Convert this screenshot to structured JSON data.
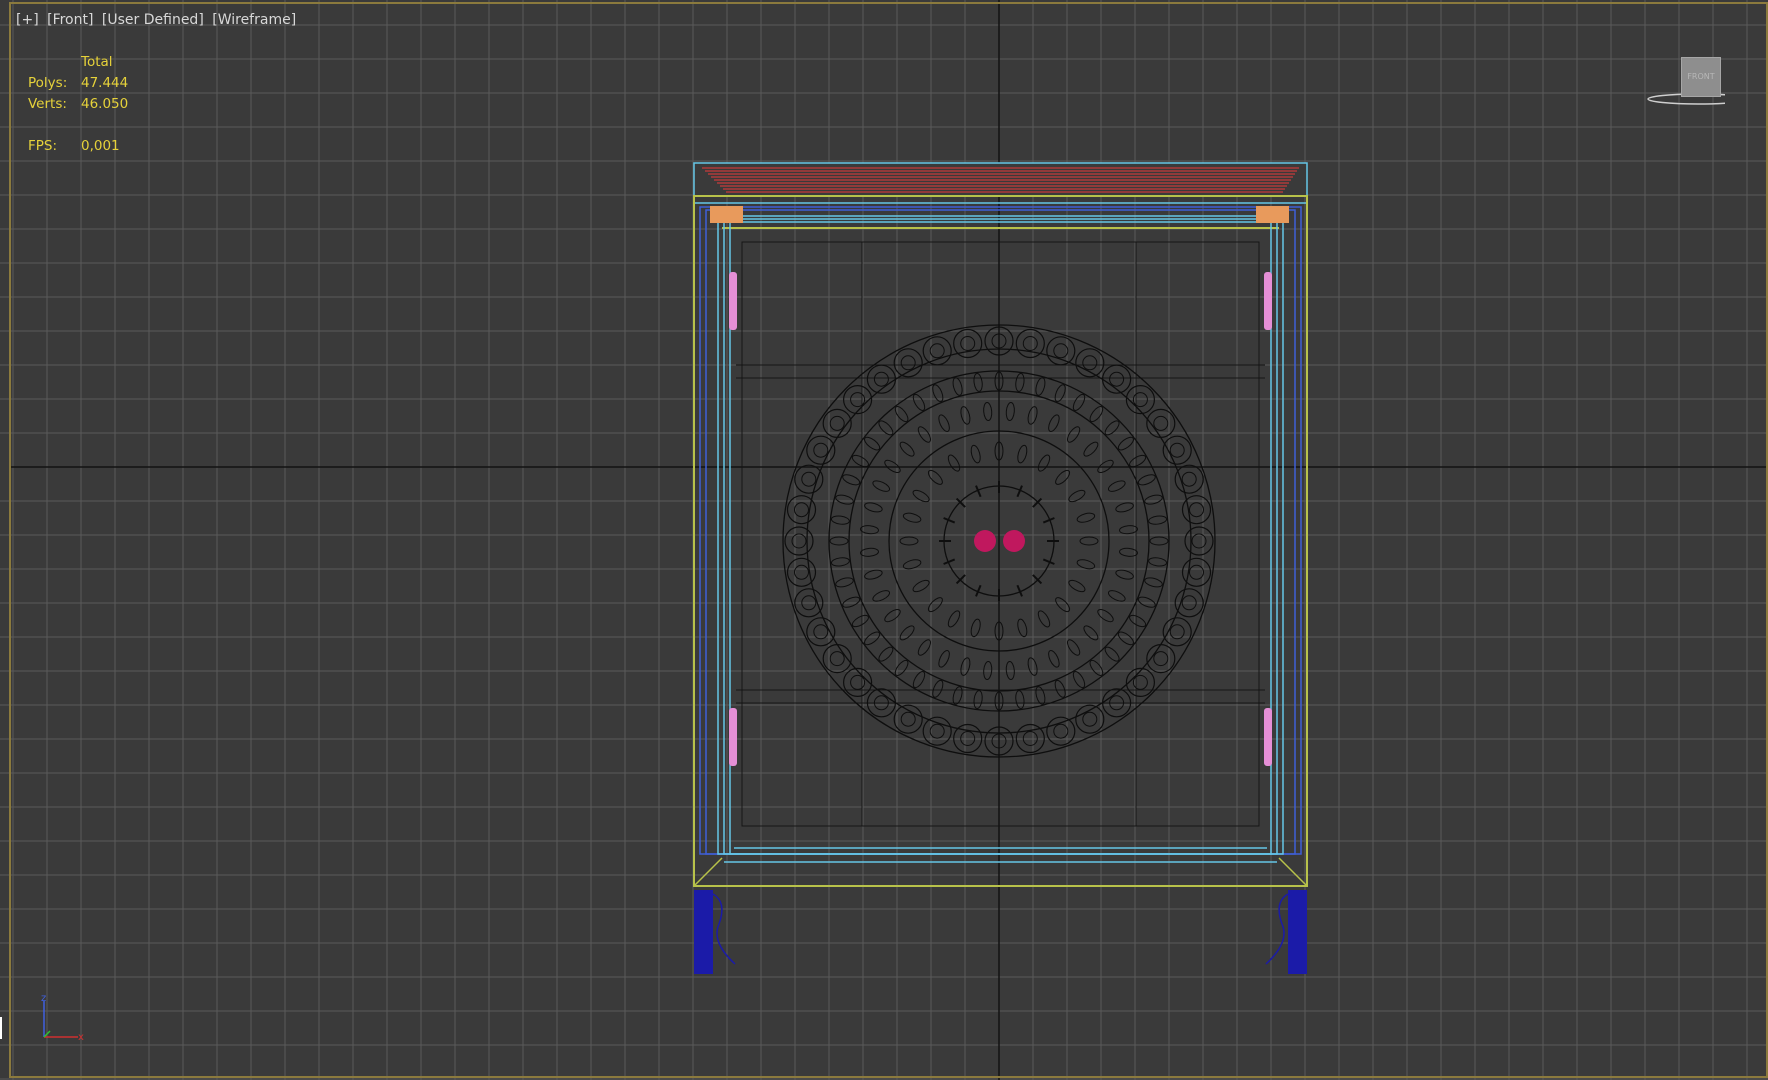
{
  "viewport": {
    "labels": [
      "[+]",
      "[Front]",
      "[User Defined]",
      "[Wireframe]"
    ],
    "label_names": [
      "viewport-menu-plus",
      "viewport-view-front",
      "viewport-shading-user-defined",
      "viewport-mode-wireframe"
    ]
  },
  "stats": {
    "header": "Total",
    "polys_label": "Polys:",
    "polys_value": "47.444",
    "verts_label": "Verts:",
    "verts_value": "46.050",
    "fps_label": "FPS:",
    "fps_value": "0,001"
  },
  "viewcube": {
    "face_label": "FRONT"
  },
  "axis_gizmo": {
    "z_label": "z",
    "x_label": "x"
  },
  "colors": {
    "background": "#3a3a3a",
    "grid_line": "#5a5a5a",
    "grid_major": "#121212",
    "stats_text": "#e6d23a",
    "frame_border": "#8b7a3d",
    "cabinet_outer": "#b8c24a",
    "cabinet_cyan": "#64c6e6",
    "cabinet_blue": "#3e5fd8",
    "top_slab": "#c83a3a",
    "hinge_orange": "#e89a5c",
    "handle_pink": "#e58fd6",
    "feet_blue": "#1b1ba8",
    "knob_magenta": "#c0185e",
    "ornament_line": "#0e0e0e"
  },
  "icons": {
    "viewcube": "viewcube-icon",
    "axis": "axis-tripod-icon"
  }
}
